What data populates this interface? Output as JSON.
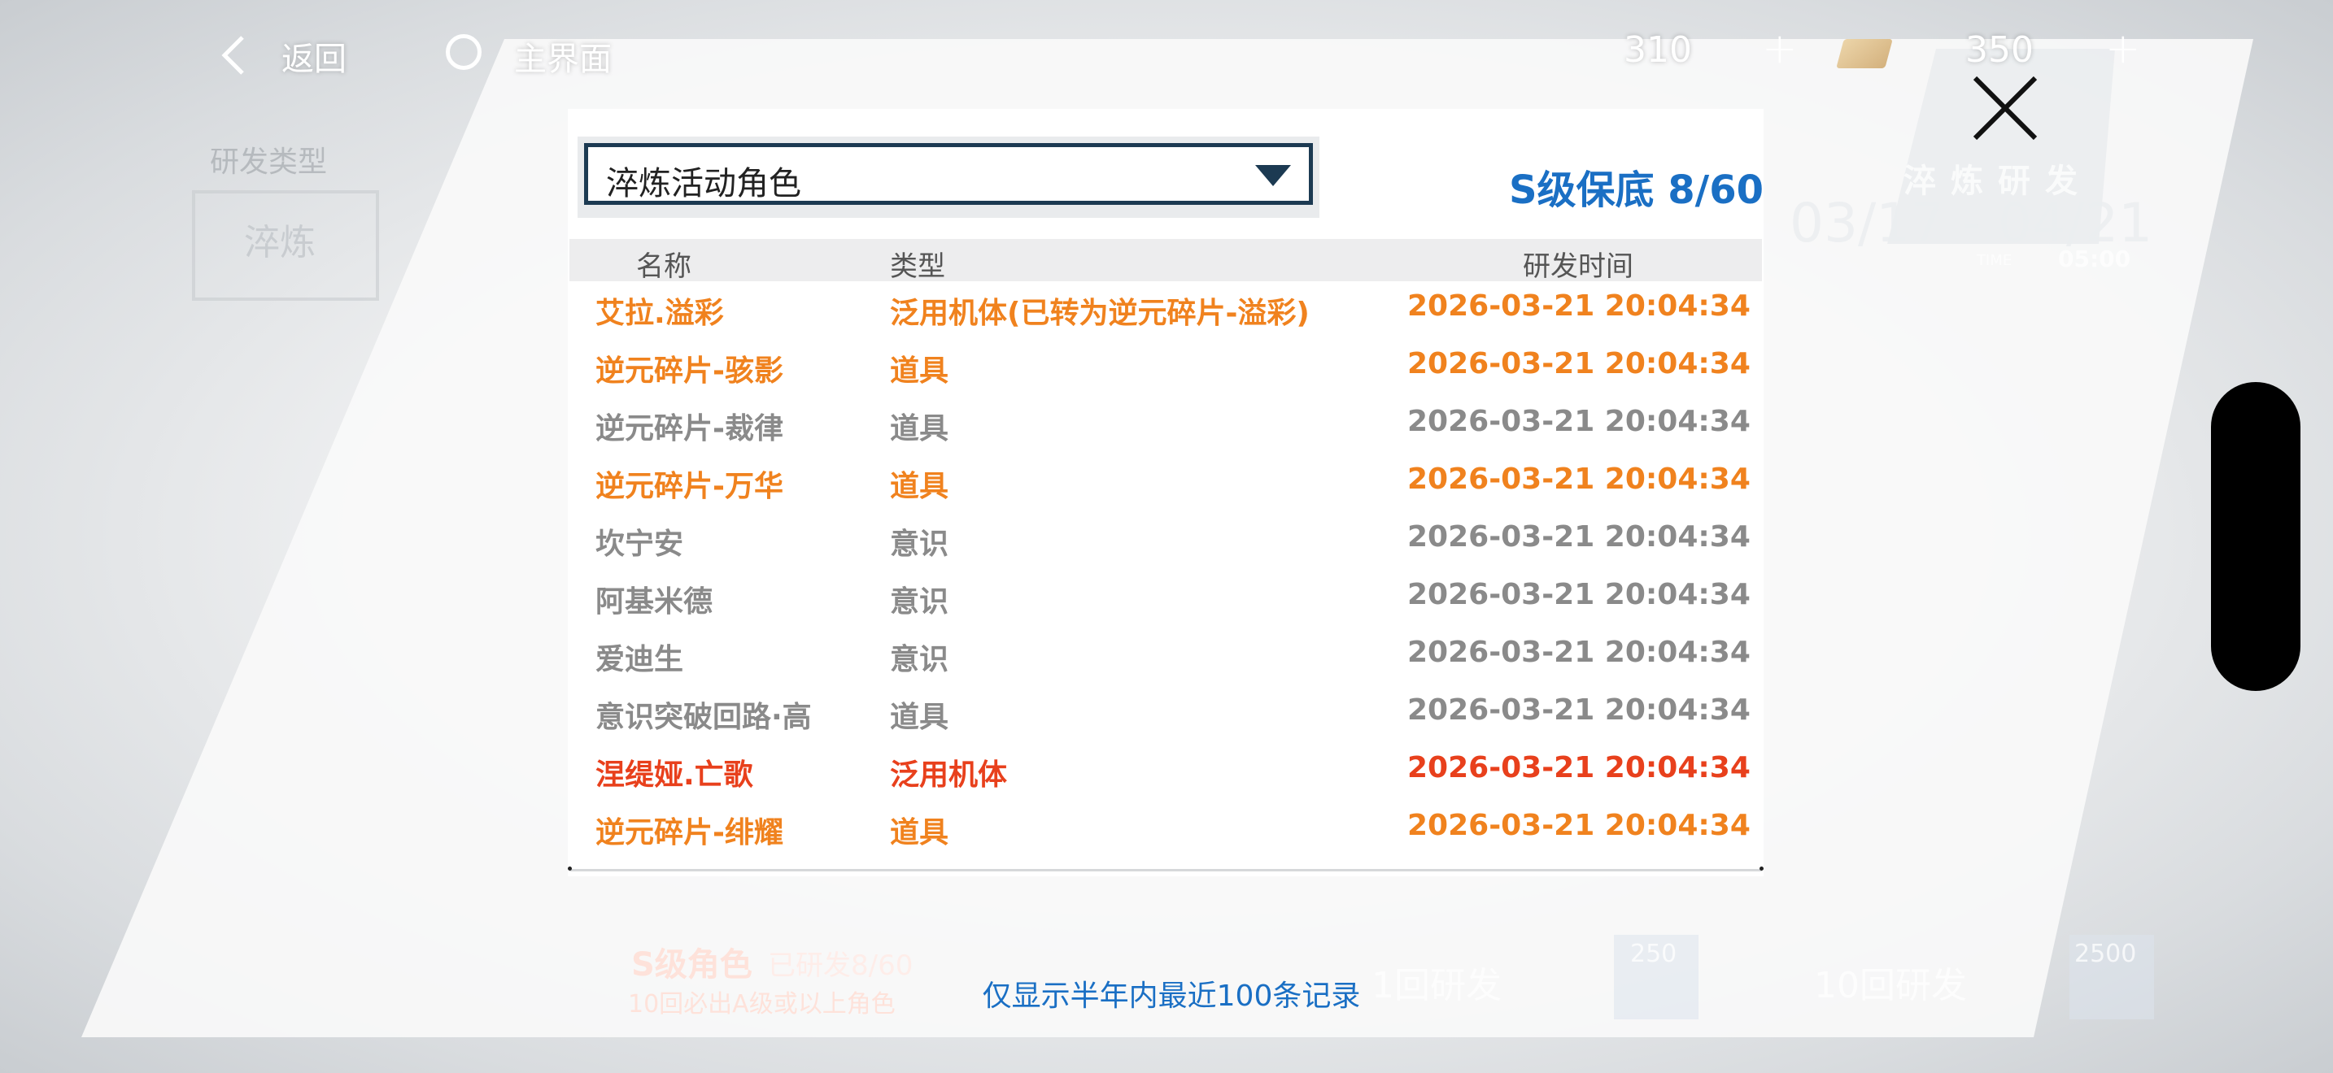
{
  "topbar": {
    "back_label": "返回",
    "home_label": "主界面",
    "resource1_value": "310",
    "resource2_value": "350",
    "plus": "+"
  },
  "background": {
    "category_label": "研发类型",
    "category_button": "淬炼",
    "event_title": "淬炼研发",
    "event_dates": "03/17 - 04/21",
    "event_time_label": "TIME",
    "event_time": "05:00",
    "guarantee_title": "S级角色",
    "guarantee_progress": "已研发8/60",
    "guarantee_rule": "10回必出A级或以上角色",
    "draw1_label": "1回研发",
    "draw1_cost": "250",
    "draw10_label": "10回研发",
    "draw10_cost": "2500"
  },
  "modal": {
    "dropdown_value": "淬炼活动角色",
    "pity_text": "S级保底 8/60",
    "columns": {
      "name": "名称",
      "type": "类型",
      "time": "研发时间"
    },
    "rows": [
      {
        "name": "艾拉.溢彩",
        "type": "泛用机体(已转为逆元碎片-溢彩)",
        "time": "2026-03-21 20:04:34",
        "color": "#f0821e"
      },
      {
        "name": "逆元碎片-骇影",
        "type": "道具",
        "time": "2026-03-21 20:04:34",
        "color": "#f0821e"
      },
      {
        "name": "逆元碎片-裁律",
        "type": "道具",
        "time": "2026-03-21 20:04:34",
        "color": "#8a8a8a"
      },
      {
        "name": "逆元碎片-万华",
        "type": "道具",
        "time": "2026-03-21 20:04:34",
        "color": "#f0821e"
      },
      {
        "name": "坎宁安",
        "type": "意识",
        "time": "2026-03-21 20:04:34",
        "color": "#8a8a8a"
      },
      {
        "name": "阿基米德",
        "type": "意识",
        "time": "2026-03-21 20:04:34",
        "color": "#8a8a8a"
      },
      {
        "name": "爱迪生",
        "type": "意识",
        "time": "2026-03-21 20:04:34",
        "color": "#8a8a8a"
      },
      {
        "name": "意识突破回路·高",
        "type": "道具",
        "time": "2026-03-21 20:04:34",
        "color": "#8a8a8a"
      },
      {
        "name": "涅缇娅.亡歌",
        "type": "泛用机体",
        "time": "2026-03-21 20:04:34",
        "color": "#e8401c"
      },
      {
        "name": "逆元碎片-绯耀",
        "type": "道具",
        "time": "2026-03-21 20:04:34",
        "color": "#f0821e"
      }
    ],
    "footnote": "仅显示半年内最近100条记录"
  },
  "colors": {
    "accent_blue": "#1a6fc4",
    "dropdown_border": "#1c3a52",
    "rarity_s": "#e8401c",
    "rarity_a": "#f0821e",
    "rarity_b": "#8a8a8a"
  }
}
